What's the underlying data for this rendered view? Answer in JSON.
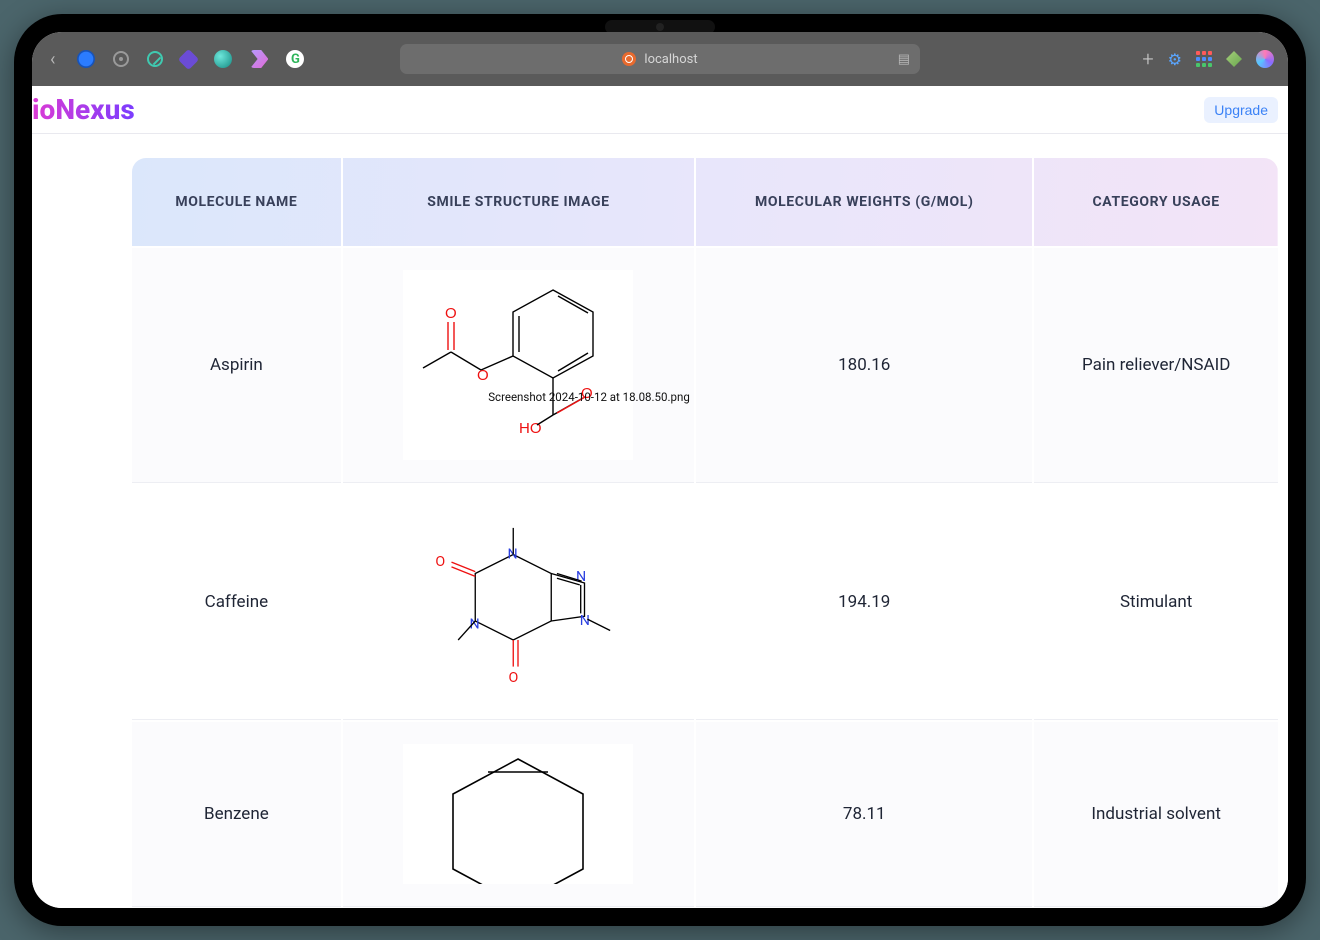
{
  "browser": {
    "url_label": "localhost",
    "favicons": [
      {
        "name": "circle-blue",
        "color": "#2b7cff"
      },
      {
        "name": "target-grey",
        "color": "#a6a6a6"
      },
      {
        "name": "slash-teal",
        "color": "#3fc9b0"
      },
      {
        "name": "diamond-purple",
        "color": "#6b4cd6"
      },
      {
        "name": "orb-teal",
        "color": "#35b8b0"
      },
      {
        "name": "k-pink",
        "color": "#e06bd6"
      },
      {
        "name": "g-green",
        "color": "#2fb55a"
      }
    ],
    "right_icons": [
      "plus",
      "shield",
      "grid",
      "leaf",
      "swirl"
    ]
  },
  "header": {
    "brand": "ioNexus",
    "upgrade_label": "Upgrade"
  },
  "table": {
    "columns": [
      "Molecule Name",
      "Smile Structure Image",
      "Molecular Weights (g/mol)",
      "Category Usage"
    ],
    "rows": [
      {
        "name": "Aspirin",
        "structure_id": "aspirin",
        "overlay_caption": "Screenshot 2024-10-12 at 18.08.50.png",
        "weight": "180.16",
        "usage": "Pain reliever/NSAID"
      },
      {
        "name": "Caffeine",
        "structure_id": "caffeine",
        "overlay_caption": "",
        "weight": "194.19",
        "usage": "Stimulant"
      },
      {
        "name": "Benzene",
        "structure_id": "benzene",
        "overlay_caption": "",
        "weight": "78.11",
        "usage": "Industrial solvent"
      }
    ]
  }
}
